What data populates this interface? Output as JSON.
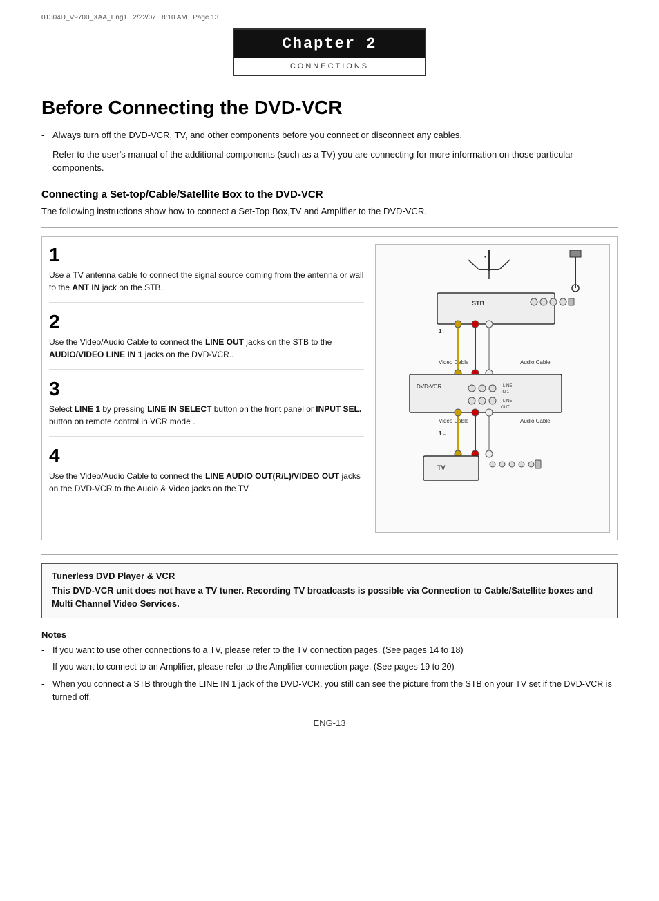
{
  "meta": {
    "filename": "01304D_V9700_XAA_Eng1",
    "date": "2/22/07",
    "time": "8:10 AM",
    "page": "Page 13"
  },
  "chapter": {
    "title": "Chapter 2",
    "subtitle": "CONNECTIONS"
  },
  "page_title": "Before Connecting the DVD-VCR",
  "intro_bullets": [
    "Always turn off the DVD-VCR, TV, and other components before you connect or disconnect any cables.",
    "Refer to the user's manual of the additional components (such as a TV) you are connecting for more information on those particular components."
  ],
  "section": {
    "title": "Connecting a Set-top/Cable/Satellite Box to the DVD-VCR",
    "description": "The following instructions show how to connect a Set-Top Box,TV and Amplifier to the DVD-VCR."
  },
  "steps": [
    {
      "number": "1",
      "text": "Use a TV antenna cable to connect the signal source coming from the antenna or wall to the <b>ANT IN</b> jack on the STB."
    },
    {
      "number": "2",
      "text": "Use the Video/Audio Cable to connect the <b>LINE OUT</b> jacks on the STB to the <b>AUDIO/VIDEO LINE IN 1</b> jacks on the DVD-VCR.."
    },
    {
      "number": "3",
      "text": "Select <b>LINE 1</b> by pressing <b>LINE IN SELECT</b> button on the front panel or <b>INPUT SEL.</b> button on remote control in VCR mode ."
    },
    {
      "number": "4",
      "text": "Use the Video/Audio Cable to connect the <b>LINE AUDIO OUT(R/L)/VIDEO OUT</b> jacks on the DVD-VCR to the Audio & Video jacks on the TV."
    }
  ],
  "note_box": {
    "title": "Tunerless DVD Player & VCR",
    "body": "This DVD-VCR unit does not have a TV tuner. Recording TV broadcasts is possible via Connection to Cable/Satellite boxes and Multi Channel Video Services."
  },
  "notes": {
    "title": "Notes",
    "items": [
      "If you want to use other connections to a TV, please refer to the TV connection pages. (See pages 14 to 18)",
      "If you want to connect to an Amplifier, please refer to the Amplifier connection page. (See pages 19 to 20)",
      "When you connect a STB through the LINE IN 1 jack of the DVD-VCR, you still can see the picture from the STB  on your TV set if the DVD-VCR is turned off."
    ]
  },
  "footer": "ENG-13"
}
